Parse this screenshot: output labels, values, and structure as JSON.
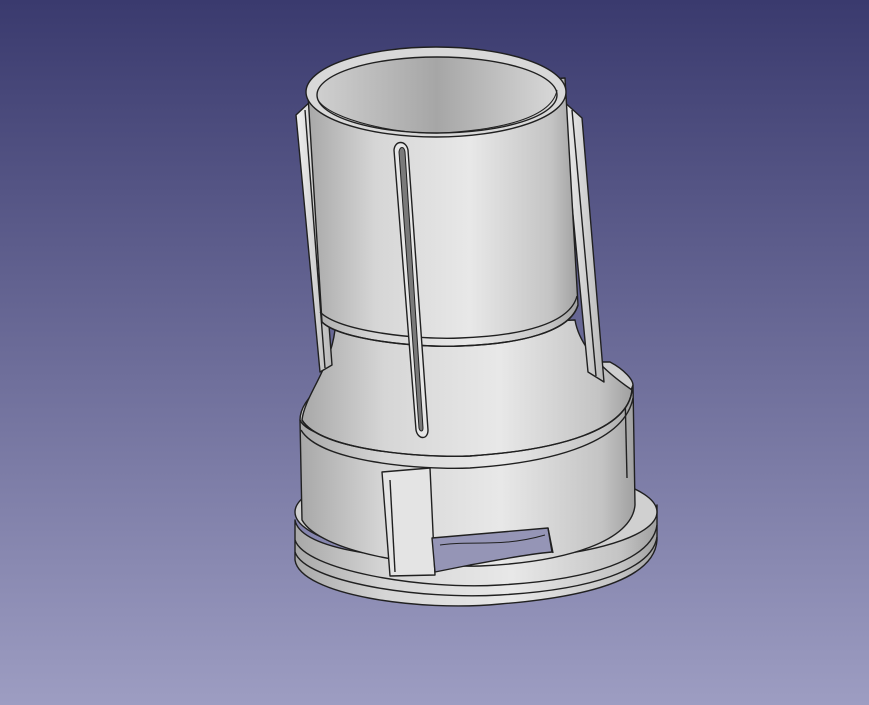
{
  "viewport": {
    "background_top": "#3a3a6e",
    "background_bottom": "#9d9dc2"
  },
  "model": {
    "body_light": "#e3e3e3",
    "body_mid": "#bdbdbd",
    "body_dark": "#8e8e8e",
    "edge_color": "#202020"
  }
}
